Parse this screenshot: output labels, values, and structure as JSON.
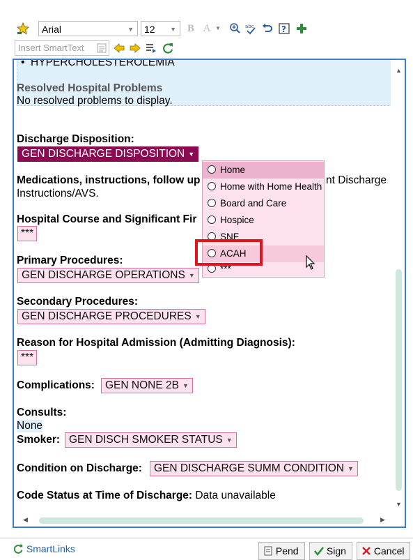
{
  "toolbar": {
    "font_name": "Arial",
    "font_size": "12",
    "icons": [
      "favorite-star-icon",
      "bold-icon",
      "font-color-icon",
      "zoom-icon",
      "spellcheck-icon",
      "undo-icon",
      "help-icon",
      "add-icon",
      "insert-smarttext-list-icon",
      "back-arrow-icon",
      "forward-arrow-icon",
      "lines-icon",
      "refresh-icon"
    ],
    "bold_glyph": "B",
    "font_color_glyph": "A",
    "insert_smarttext_placeholder": "Insert SmartText"
  },
  "note": {
    "problem_item": "HYPERCHOLESTEROLEMIA",
    "resolved_heading": "Resolved Hospital Problems",
    "resolved_text": "No resolved problems to display.",
    "discharge_disposition_label": "Discharge Disposition:",
    "discharge_disposition_chip": "GEN DISCHARGE DISPOSITION",
    "medications_label": "Medications, instructions, follow up",
    "medications_suffix": "nt Discharge",
    "medications_line2": "Instructions/AVS.",
    "hospital_course_label": "Hospital Course and Significant Fir",
    "hospital_course_chip": "***",
    "primary_procedures_label": "Primary Procedures:",
    "primary_procedures_chip": "GEN DISCHARGE OPERATIONS",
    "secondary_procedures_label": "Secondary Procedures:",
    "secondary_procedures_chip": "GEN DISCHARGE PROCEDURES",
    "reason_label": "Reason for Hospital Admission (Admitting Diagnosis):",
    "reason_chip": "***",
    "complications_label": "Complications:",
    "complications_chip": "GEN NONE 2B",
    "consults_label": "Consults:",
    "consults_value": "None",
    "smoker_label": "Smoker:",
    "smoker_chip": "GEN DISCH SMOKER STATUS",
    "condition_label": "Condition on Discharge:",
    "condition_chip": "GEN DISCHARGE SUMM CONDITION",
    "code_status_label": "Code Status at Time of Discharge:",
    "code_status_value": "Data unavailable"
  },
  "dropdown": {
    "options": [
      "Home",
      "Home with Home Health",
      "Board and Care",
      "Hospice",
      "SNF",
      "ACAH",
      "***"
    ],
    "selected": "Home",
    "highlighted": "ACAH"
  },
  "footer": {
    "smartlinks_label": "SmartLinks",
    "pend_label": "Pend",
    "sign_label": "Sign",
    "cancel_label": "Cancel"
  },
  "colors": {
    "accent_border": "#3a7bd5",
    "chip_bg": "#fde2ee",
    "chip_active_bg": "#8b0a52",
    "highlight_box": "#e0141c"
  }
}
